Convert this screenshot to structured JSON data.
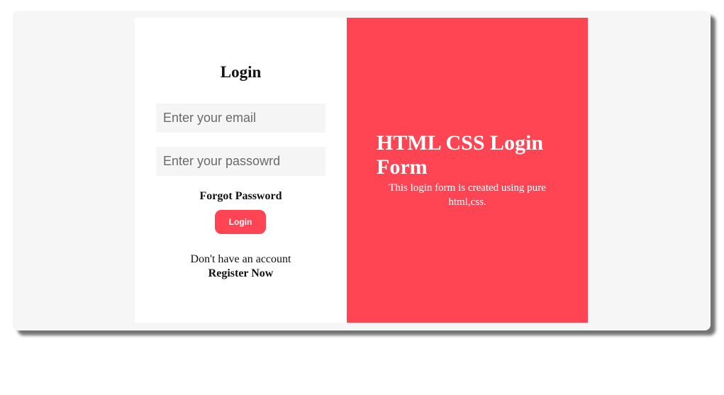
{
  "login_form": {
    "title": "Login",
    "email_placeholder": "Enter your email",
    "password_placeholder": "Enter your passowrd",
    "forgot_password": "Forgot Password",
    "login_button": "Login",
    "no_account_text": "Don't have an account",
    "register_link": "Register Now"
  },
  "hero": {
    "title": "HTML CSS Login Form",
    "subtitle": "This login form is created using pure html,css."
  },
  "colors": {
    "accent": "#ff4554",
    "field_background": "#f5f5f5",
    "page_background": "#f6f6f6"
  }
}
